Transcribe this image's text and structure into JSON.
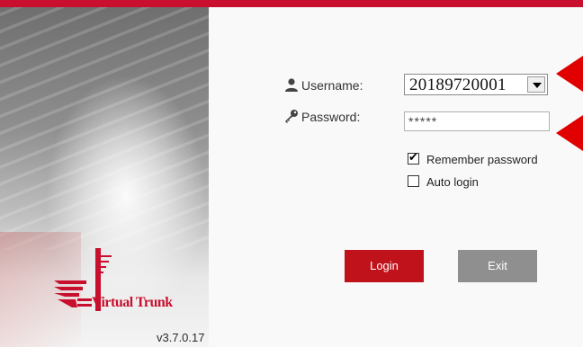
{
  "login": {
    "username_label": "Username:",
    "username_value": "20189720001",
    "password_label": "Password:",
    "password_value": "*****",
    "remember_label": "Remember password",
    "remember_checked": true,
    "auto_login_label": "Auto login",
    "auto_login_checked": false,
    "login_button": "Login",
    "exit_button": "Exit"
  },
  "brand": {
    "logo_text": "Virtual Trunk",
    "version": "v3.7.0.17"
  },
  "colors": {
    "accent_red": "#c8102e",
    "exit_gray": "#8f8f8f",
    "arrow_red": "#e00000"
  },
  "icons": [
    "user-icon",
    "key-icon",
    "chevron-down-icon",
    "checkmark-icon"
  ]
}
